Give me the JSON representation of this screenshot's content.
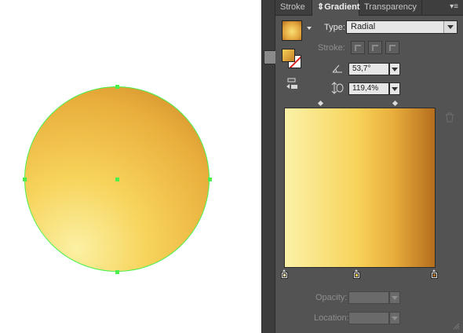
{
  "canvas": {
    "object": "radial-gradient-circle",
    "selection_color": "#4cf04c"
  },
  "panel": {
    "tabs": [
      {
        "label": "Stroke",
        "active": false
      },
      {
        "label": "Gradient",
        "active": true
      },
      {
        "label": "Transparency",
        "active": false
      }
    ],
    "active_tab_marker": "⇕",
    "menu_icon": "panel-menu-icon",
    "type_label": "Type:",
    "type_value": "Radial",
    "stroke_label": "Stroke:",
    "angle_value": "53,7°",
    "aspect_value": "119,4%",
    "opacity_label": "Opacity:",
    "location_label": "Location:",
    "opacity_value": "",
    "location_value": "",
    "gradient_stops": [
      {
        "location": 0,
        "color": "#fbf2a8"
      },
      {
        "location": 48,
        "color": "#f7d35a"
      },
      {
        "location": 100,
        "color": "#b56e1e"
      }
    ],
    "midpoints": [
      21,
      74
    ]
  },
  "colors": {
    "panel_bg": "#535353",
    "tab_bg": "#3e3e3e",
    "gradient_light": "#fbf2a8",
    "gradient_mid": "#f7d35a",
    "gradient_dark": "#b56e1e"
  }
}
